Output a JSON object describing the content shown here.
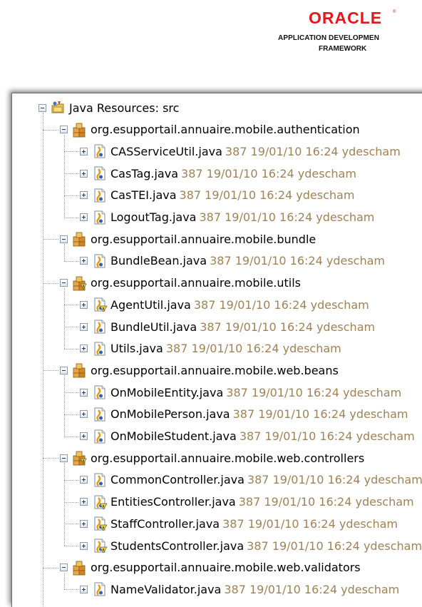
{
  "logo": {
    "brand": "ORACLE",
    "mark": "®",
    "line1": "APPLICATION DEVELOPMEN",
    "line2": "FRAMEWORK",
    "color": "#e8151b"
  },
  "colors": {
    "meta": "#a28155"
  },
  "tree": {
    "root": {
      "label": "Java Resources: src",
      "icon": "source-folder-icon",
      "expanded": true
    },
    "packages": [
      {
        "label": "org.esupportail.annuaire.mobile.authentication",
        "icon": "package-icon",
        "files": [
          {
            "name": "CASServiceUtil.java",
            "meta": "387  19/01/10 16:24  ydescham",
            "icon": "java-file-icon"
          },
          {
            "name": "CasTag.java",
            "meta": "387  19/01/10 16:24  ydescham",
            "icon": "java-file-icon"
          },
          {
            "name": "CasTEI.java",
            "meta": "387  19/01/10 16:24  ydescham",
            "icon": "java-file-icon"
          },
          {
            "name": "LogoutTag.java",
            "meta": "387  19/01/10 16:24  ydescham",
            "icon": "java-file-icon"
          }
        ]
      },
      {
        "label": "org.esupportail.annuaire.mobile.bundle",
        "icon": "package-icon",
        "files": [
          {
            "name": "BundleBean.java",
            "meta": "387  19/01/10 16:24  ydescham",
            "icon": "java-file-icon"
          }
        ]
      },
      {
        "label": "org.esupportail.annuaire.mobile.utils",
        "icon": "package-warning-icon",
        "files": [
          {
            "name": "AgentUtil.java",
            "meta": "387  19/01/10 16:24  ydescham",
            "icon": "java-file-warning-icon"
          },
          {
            "name": "BundleUtil.java",
            "meta": "387  19/01/10 16:24  ydescham",
            "icon": "java-file-icon"
          },
          {
            "name": "Utils.java",
            "meta": "387  19/01/10 16:24  ydescham",
            "icon": "java-file-icon"
          }
        ]
      },
      {
        "label": "org.esupportail.annuaire.mobile.web.beans",
        "icon": "package-icon",
        "files": [
          {
            "name": "OnMobileEntity.java",
            "meta": "387  19/01/10 16:24  ydescham",
            "icon": "java-file-icon"
          },
          {
            "name": "OnMobilePerson.java",
            "meta": "387  19/01/10 16:24  ydescham",
            "icon": "java-file-icon"
          },
          {
            "name": "OnMobileStudent.java",
            "meta": "387  19/01/10 16:24  ydescham",
            "icon": "java-file-icon"
          }
        ]
      },
      {
        "label": "org.esupportail.annuaire.mobile.web.controllers",
        "icon": "package-warning-icon",
        "files": [
          {
            "name": "CommonController.java",
            "meta": "387  19/01/10 16:24  ydescham",
            "icon": "java-file-icon"
          },
          {
            "name": "EntitiesController.java",
            "meta": "387  19/01/10 16:24  ydescham",
            "icon": "java-file-warning-icon"
          },
          {
            "name": "StaffController.java",
            "meta": "387  19/01/10 16:24  ydescham",
            "icon": "java-file-warning-icon"
          },
          {
            "name": "StudentsController.java",
            "meta": "387  19/01/10 16:24  ydescham",
            "icon": "java-file-warning-icon"
          }
        ]
      },
      {
        "label": "org.esupportail.annuaire.mobile.web.validators",
        "icon": "package-icon",
        "files": [
          {
            "name": "NameValidator.java",
            "meta": "387  19/01/10 16:24  ydescham",
            "icon": "java-file-icon"
          }
        ]
      }
    ]
  }
}
